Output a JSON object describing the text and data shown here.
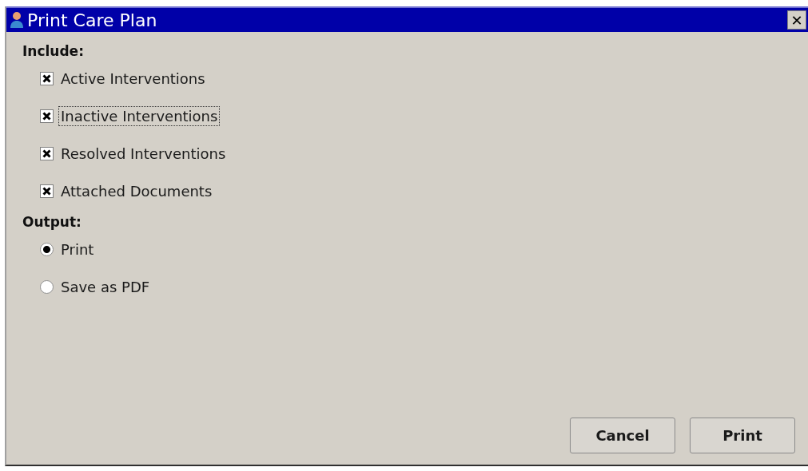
{
  "window": {
    "title": "Print Care Plan",
    "close": "✕"
  },
  "include": {
    "heading": "Include:",
    "options": [
      {
        "label": "Active Interventions",
        "checked": true,
        "focused": false
      },
      {
        "label": "Inactive Interventions",
        "checked": true,
        "focused": true
      },
      {
        "label": "Resolved Interventions",
        "checked": true,
        "focused": false
      },
      {
        "label": "Attached Documents",
        "checked": true,
        "focused": false
      }
    ]
  },
  "output": {
    "heading": "Output:",
    "options": [
      {
        "label": "Print",
        "selected": true
      },
      {
        "label": "Save as PDF",
        "selected": false
      }
    ]
  },
  "buttons": [
    "Cancel",
    "Print"
  ]
}
